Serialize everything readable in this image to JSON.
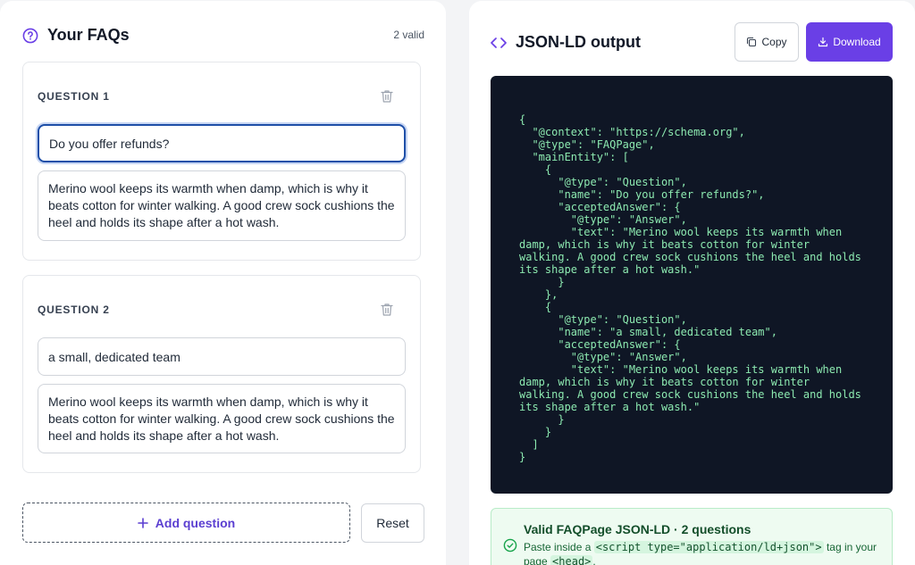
{
  "left": {
    "title": "Your FAQs",
    "valid_count": "2 valid",
    "questions": [
      {
        "label": "QUESTION 1",
        "question": "Do you offer refunds?",
        "answer": "Merino wool keeps its warmth when damp, which is why it beats cotton for winter walking. A good crew sock cushions the heel and holds its shape after a hot wash."
      },
      {
        "label": "QUESTION 2",
        "question": "a small, dedicated team",
        "answer": "Merino wool keeps its warmth when damp, which is why it beats cotton for winter walking. A good crew sock cushions the heel and holds its shape after a hot wash."
      }
    ],
    "add_label": "Add question",
    "reset_label": "Reset"
  },
  "right": {
    "title": "JSON-LD output",
    "copy_label": "Copy",
    "download_label": "Download",
    "code": "{\n  \"@context\": \"https://schema.org\",\n  \"@type\": \"FAQPage\",\n  \"mainEntity\": [\n    {\n      \"@type\": \"Question\",\n      \"name\": \"Do you offer refunds?\",\n      \"acceptedAnswer\": {\n        \"@type\": \"Answer\",\n        \"text\": \"Merino wool keeps its warmth when\ndamp, which is why it beats cotton for winter\nwalking. A good crew sock cushions the heel and holds\nits shape after a hot wash.\"\n      }\n    },\n    {\n      \"@type\": \"Question\",\n      \"name\": \"a small, dedicated team\",\n      \"acceptedAnswer\": {\n        \"@type\": \"Answer\",\n        \"text\": \"Merino wool keeps its warmth when\ndamp, which is why it beats cotton for winter\nwalking. A good crew sock cushions the heel and holds\nits shape after a hot wash.\"\n      }\n    }\n  ]\n}",
    "valid_title": "Valid FAQPage JSON-LD · 2 questions",
    "valid_desc_prefix": "Paste inside a",
    "valid_desc_code1": "<script type=\"application/ld+json\">",
    "valid_desc_middle": "tag in your page",
    "valid_desc_code2": "<head>",
    "valid_desc_suffix": "."
  },
  "colors": {
    "accent": "#6a3fe6",
    "code_bg": "#0f1625",
    "code_text": "#8ce9b0",
    "success_bg": "#eefbf1"
  },
  "icons": [
    "question-circle-icon",
    "trash-icon",
    "plus-icon",
    "code-brackets-icon",
    "copy-icon",
    "download-icon",
    "check-circle-icon"
  ]
}
